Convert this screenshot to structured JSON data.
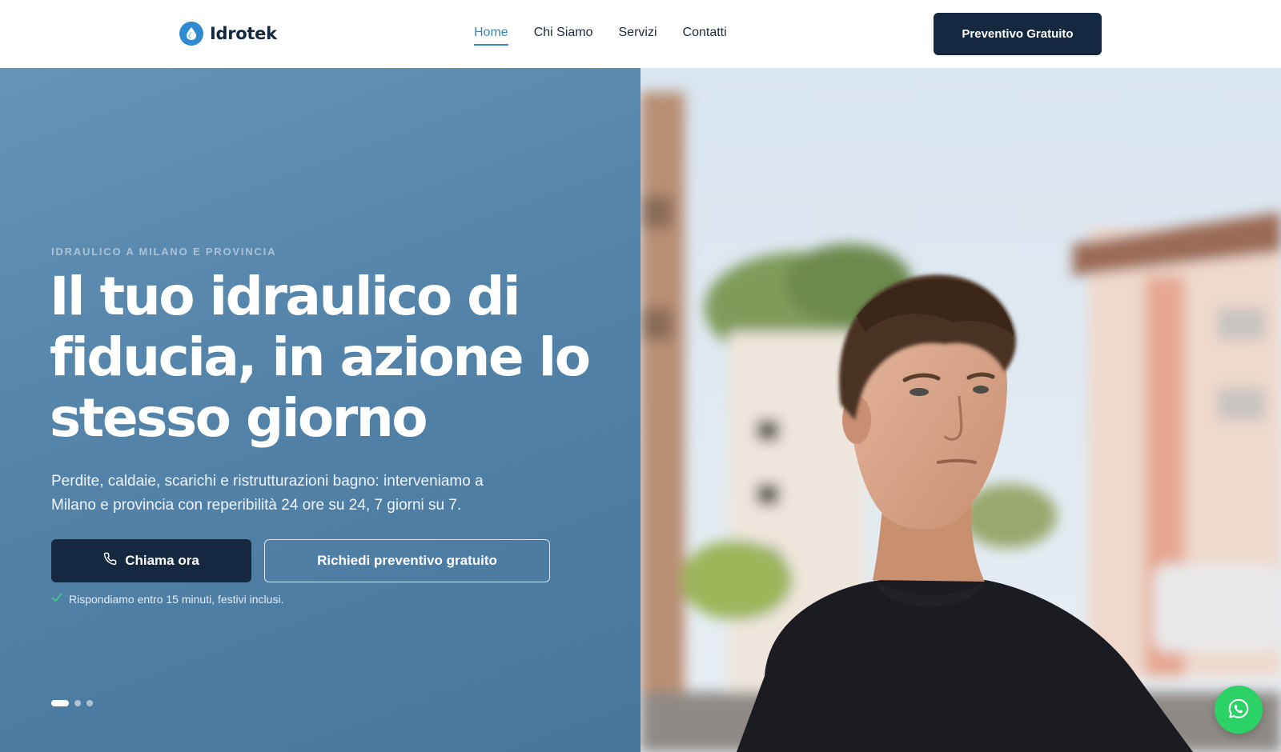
{
  "brand": {
    "name": "Idrotek",
    "icon": "water-drop-icon",
    "color": "#2f8ad0"
  },
  "nav": {
    "items": [
      {
        "label": "Home",
        "active": true
      },
      {
        "label": "Chi Siamo",
        "active": false
      },
      {
        "label": "Servizi",
        "active": false
      },
      {
        "label": "Contatti",
        "active": false
      }
    ]
  },
  "header": {
    "cta_label": "Preventivo Gratuito"
  },
  "hero": {
    "eyebrow": "IDRAULICO A MILANO E PROVINCIA",
    "title": "Il tuo idraulico di fiducia, in azione lo stesso giorno",
    "description": "Perdite, caldaie, scarichi e ristrutturazioni bagno: interveniamo a Milano e provincia con reperibilità 24 ore su 24, 7 giorni su 7.",
    "primary_cta": {
      "label": "Chiama ora",
      "icon": "phone-icon"
    },
    "secondary_cta": {
      "label": "Richiedi preventivo gratuito"
    },
    "reassurance": {
      "text": "Rispondiamo entro 15 minuti, festivi inclusi.",
      "icon": "check-icon"
    },
    "slides": {
      "count": 3,
      "active": 1
    }
  },
  "whatsapp": {
    "icon": "whatsapp-icon",
    "color": "#2bd366"
  },
  "colors": {
    "navy": "#14283f",
    "accent": "#3a86bd",
    "hero_bg": "#5383a9"
  }
}
